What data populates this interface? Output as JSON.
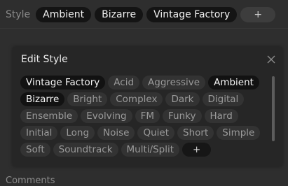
{
  "style_row": {
    "label": "Style",
    "chips": [
      "Ambient",
      "Bizarre",
      "Vintage Factory"
    ],
    "add_label": "+"
  },
  "edit_style": {
    "title": "Edit Style",
    "tags": [
      {
        "label": "Vintage Factory",
        "selected": true
      },
      {
        "label": "Acid",
        "selected": false
      },
      {
        "label": "Aggressive",
        "selected": false
      },
      {
        "label": "Ambient",
        "selected": true
      },
      {
        "label": "Bizarre",
        "selected": true
      },
      {
        "label": "Bright",
        "selected": false
      },
      {
        "label": "Complex",
        "selected": false
      },
      {
        "label": "Dark",
        "selected": false
      },
      {
        "label": "Digital",
        "selected": false
      },
      {
        "label": "Ensemble",
        "selected": false
      },
      {
        "label": "Evolving",
        "selected": false
      },
      {
        "label": "FM",
        "selected": false
      },
      {
        "label": "Funky",
        "selected": false
      },
      {
        "label": "Hard",
        "selected": false
      },
      {
        "label": "Initial",
        "selected": false
      },
      {
        "label": "Long",
        "selected": false
      },
      {
        "label": "Noise",
        "selected": false
      },
      {
        "label": "Quiet",
        "selected": false
      },
      {
        "label": "Short",
        "selected": false
      },
      {
        "label": "Simple",
        "selected": false
      },
      {
        "label": "Soft",
        "selected": false
      },
      {
        "label": "Soundtrack",
        "selected": false
      },
      {
        "label": "Multi/Split",
        "selected": false
      }
    ],
    "add_label": "+"
  },
  "comments_label": "Comments",
  "colors": {
    "background": "#2e2e2e",
    "panel": "#262626",
    "chip_selected": "#141414",
    "chip_unselected": "#333333"
  }
}
